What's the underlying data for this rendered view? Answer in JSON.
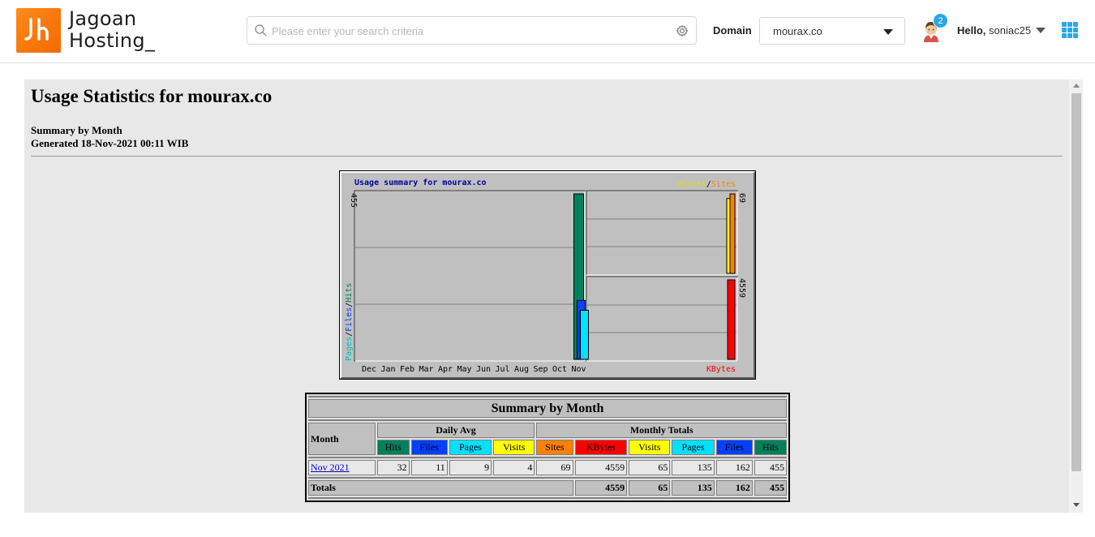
{
  "header": {
    "brand_line1": "Jagoan",
    "brand_line2": "Hosting_",
    "search_placeholder": "Please enter your search criteria",
    "domain_label": "Domain",
    "domain_value": "mourax.co",
    "notification_count": "2",
    "hello_label": "Hello,",
    "username": "soniac25",
    "accent_color": "#2aa7e8",
    "logo_color": "#f47a0a"
  },
  "page": {
    "title": "Usage Statistics for mourax.co",
    "summary_line": "Summary by Month",
    "generated_line": "Generated 18-Nov-2021 00:11 WIB"
  },
  "chart_data": {
    "type": "bar",
    "title": "Usage summary for mourax.co",
    "categories": [
      "Dec",
      "Jan",
      "Feb",
      "Mar",
      "Apr",
      "May",
      "Jun",
      "Jul",
      "Aug",
      "Sep",
      "Oct",
      "Nov"
    ],
    "panels": [
      {
        "name": "hits_files_pages",
        "axis_label_parts": [
          "Pages",
          "/",
          "Files",
          "/",
          "Hits"
        ],
        "ymax_label": "455",
        "ylim": [
          0,
          455
        ],
        "series": [
          {
            "name": "Hits",
            "color": "#00805c",
            "values": [
              0,
              0,
              0,
              0,
              0,
              0,
              0,
              0,
              0,
              0,
              0,
              455
            ]
          },
          {
            "name": "Files",
            "color": "#0040ff",
            "values": [
              0,
              0,
              0,
              0,
              0,
              0,
              0,
              0,
              0,
              0,
              0,
              162
            ]
          },
          {
            "name": "Pages",
            "color": "#00e0ff",
            "values": [
              0,
              0,
              0,
              0,
              0,
              0,
              0,
              0,
              0,
              0,
              0,
              135
            ]
          }
        ]
      },
      {
        "name": "visits_sites",
        "legend_parts": [
          "Visits",
          "/",
          "Sites"
        ],
        "ymax_label": "69",
        "ylim": [
          0,
          69
        ],
        "series": [
          {
            "name": "Visits",
            "color": "#ffff00",
            "values": [
              0,
              0,
              0,
              0,
              0,
              0,
              0,
              0,
              0,
              0,
              0,
              65
            ]
          },
          {
            "name": "Sites",
            "color": "#ff8000",
            "values": [
              0,
              0,
              0,
              0,
              0,
              0,
              0,
              0,
              0,
              0,
              0,
              69
            ]
          }
        ]
      },
      {
        "name": "kbytes",
        "legend_parts": [
          "KBytes"
        ],
        "ymax_label": "4559",
        "ylim": [
          0,
          4559
        ],
        "series": [
          {
            "name": "KBytes",
            "color": "#ff0000",
            "values": [
              0,
              0,
              0,
              0,
              0,
              0,
              0,
              0,
              0,
              0,
              0,
              4559
            ]
          }
        ]
      }
    ]
  },
  "table": {
    "title": "Summary by Month",
    "month_header": "Month",
    "daily_avg_header": "Daily Avg",
    "monthly_totals_header": "Monthly Totals",
    "daily_cols": [
      "Hits",
      "Files",
      "Pages",
      "Visits"
    ],
    "monthly_cols": [
      "Sites",
      "KBytes",
      "Visits",
      "Pages",
      "Files",
      "Hits"
    ],
    "rows": [
      {
        "month": "Nov 2021",
        "daily": [
          "32",
          "11",
          "9",
          "4"
        ],
        "monthly": [
          "69",
          "4559",
          "65",
          "135",
          "162",
          "455"
        ]
      }
    ],
    "totals": {
      "label": "Totals",
      "values": [
        "4559",
        "65",
        "135",
        "162",
        "455"
      ]
    }
  }
}
